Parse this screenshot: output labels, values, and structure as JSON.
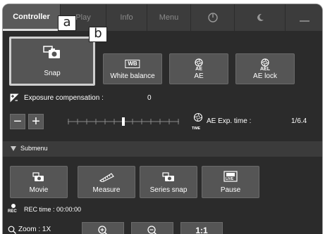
{
  "tabs": [
    {
      "label": "Controller",
      "active": true
    },
    {
      "label": "Play",
      "active": false
    },
    {
      "label": "Info",
      "active": false
    },
    {
      "label": "Menu",
      "active": false
    }
  ],
  "callouts": {
    "a": "a",
    "b": "b"
  },
  "main_buttons": {
    "snap": "Snap",
    "white_balance": "White balance",
    "white_balance_badge": "WB",
    "ae": "AE",
    "ae_badge": "AE",
    "ae_lock": "AE lock",
    "ae_lock_badge": "AEL"
  },
  "exposure": {
    "label": "Exposure compensation :",
    "value": "0",
    "minus": "−",
    "plus": "+",
    "slider_level": 0.5
  },
  "ae_exp_time": {
    "time_badge": "TIME",
    "label": "AE Exp. time :",
    "value": "1/6.4"
  },
  "submenu": {
    "label": "Submenu"
  },
  "sub_buttons": {
    "movie": "Movie",
    "measure": "Measure",
    "series_snap": "Series snap",
    "pause": "Pause",
    "pause_badge": "LIVE"
  },
  "rec": {
    "badge": "REC",
    "label": "REC time : 00:00:00"
  },
  "zoom": {
    "label": "Zoom : 1X",
    "one_to_one": "1:1"
  },
  "colors": {
    "background": "#2b2b2b",
    "button": "#555555",
    "tabbar": "#3c3c3c",
    "active_tab": "#5a5a5a"
  }
}
